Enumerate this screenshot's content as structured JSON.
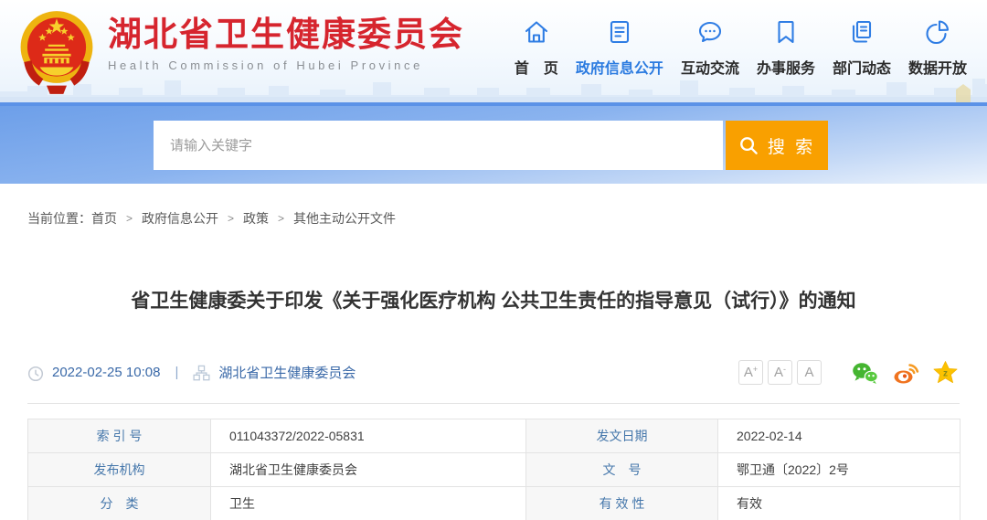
{
  "colors": {
    "brand_red": "#d6252e",
    "nav_icon_blue": "#2f7de4",
    "nav_active_blue": "#2b7be0",
    "search_button_orange": "#f9a000",
    "meta_link_blue": "#3a69a8",
    "table_label_blue": "#4577ab",
    "wechat_green": "#45b531",
    "weibo_orange": "#f0731f",
    "qzone_gold": "#fcc200"
  },
  "header": {
    "logo_icon": "china-national-emblem",
    "site_title": "湖北省卫生健康委员会",
    "site_subtitle": "Health Commission of Hubei Province",
    "nav": [
      {
        "label": "首　页",
        "icon": "home-icon"
      },
      {
        "label": "政府信息公开",
        "icon": "document-icon"
      },
      {
        "label": "互动交流",
        "icon": "chat-bubble-icon"
      },
      {
        "label": "办事服务",
        "icon": "bookmark-icon"
      },
      {
        "label": "部门动态",
        "icon": "pages-icon"
      },
      {
        "label": "数据开放",
        "icon": "pie-chart-icon"
      }
    ]
  },
  "search": {
    "placeholder": "请输入关键字",
    "button_label": "搜 索"
  },
  "breadcrumb": {
    "label": "当前位置：",
    "separator": ">",
    "items": [
      "首页",
      "政府信息公开",
      "政策",
      "其他主动公开文件"
    ]
  },
  "article": {
    "title": "省卫生健康委关于印发《关于强化医疗机构 公共卫生责任的指导意见（试行）》的通知",
    "publish_time": "2022-02-25 10:08",
    "meta_divider": "|",
    "source": "湖北省卫生健康委员会",
    "font_size_controls": [
      {
        "base": "A",
        "mod": "+"
      },
      {
        "base": "A",
        "mod": "-"
      },
      {
        "base": "A",
        "mod": ""
      }
    ],
    "share_icons": [
      "wechat-icon",
      "weibo-icon",
      "qzone-star-icon"
    ]
  },
  "doc_table": {
    "rows": [
      {
        "c0_label": "索 引 号",
        "c0_value": "011043372/2022-05831",
        "c1_label": "发文日期",
        "c1_value": "2022-02-14"
      },
      {
        "c0_label": "发布机构",
        "c0_value": "湖北省卫生健康委员会",
        "c1_label": "文　号",
        "c1_value": "鄂卫通〔2022〕2号"
      },
      {
        "c0_label": "分　类",
        "c0_value": "卫生",
        "c1_label": "有 效 性",
        "c1_value": "有效"
      }
    ]
  }
}
